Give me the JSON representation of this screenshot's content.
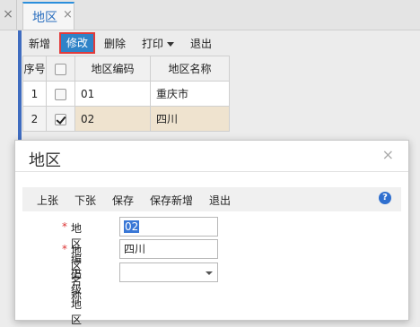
{
  "tabs": {
    "close_glyph": "×",
    "active_label": "地区",
    "active_close": "×"
  },
  "toolbar": {
    "add": "新增",
    "modify": "修改",
    "delete": "删除",
    "print": "打印",
    "exit": "退出"
  },
  "grid": {
    "headers": {
      "index": "序号",
      "code": "地区编码",
      "name": "地区名称"
    },
    "rows": [
      {
        "index": "1",
        "code": "01",
        "name": "重庆市",
        "checked": false
      },
      {
        "index": "2",
        "code": "02",
        "name": "四川",
        "checked": true
      }
    ]
  },
  "dialog": {
    "title": "地区",
    "close": "×",
    "toolbar": {
      "prev": "上张",
      "next": "下张",
      "save": "保存",
      "save_new": "保存新增",
      "exit": "退出",
      "help": "?"
    },
    "fields": {
      "code_label": "地区编码",
      "code_value": "02",
      "name_label": "地区名称",
      "name_value": "四川",
      "parent_label": "上级地区",
      "parent_value": "",
      "required_mark": "*"
    }
  }
}
